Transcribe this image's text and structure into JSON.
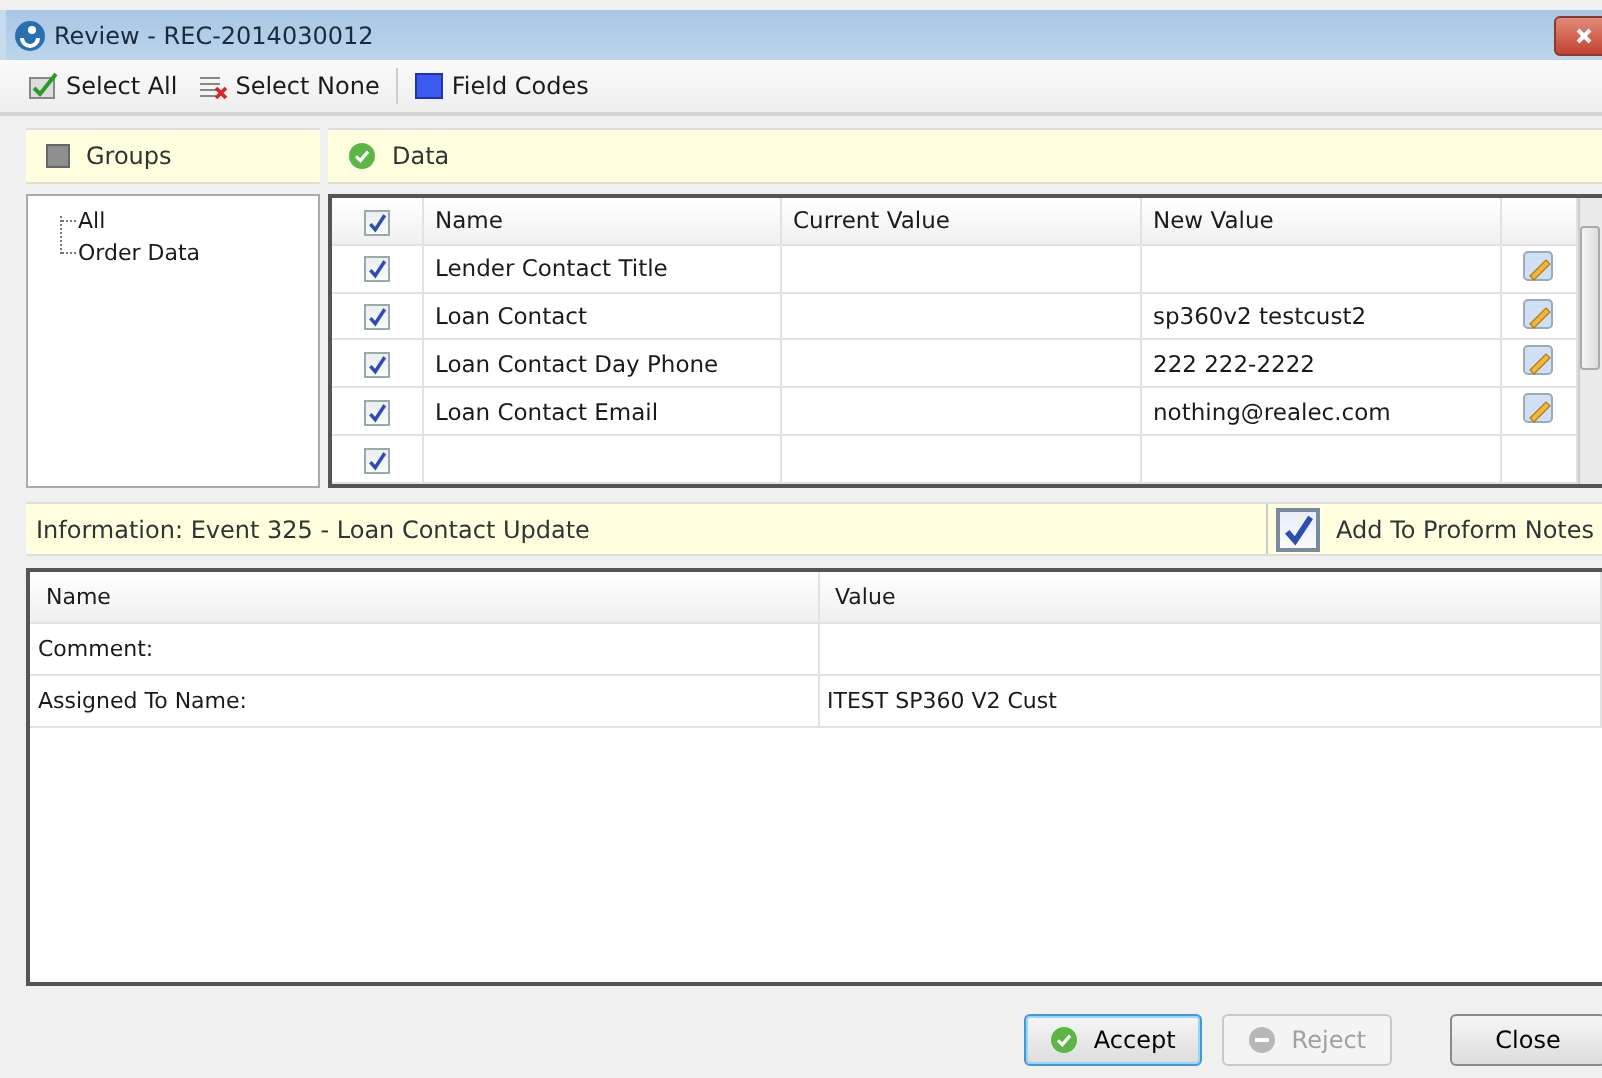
{
  "window": {
    "title": "Review - REC-2014030012"
  },
  "toolbar": [
    {
      "kind": "select-all",
      "label": "Select All"
    },
    {
      "kind": "select-none",
      "label": "Select None"
    },
    {
      "kind": "field-codes",
      "label": "Field Codes"
    }
  ],
  "groups": {
    "title": "Groups",
    "tree": [
      {
        "label": "All"
      },
      {
        "label": "Order Data"
      }
    ]
  },
  "data": {
    "title": "Data",
    "header_checked": true,
    "columns": [
      "Name",
      "Current Value",
      "New Value"
    ],
    "rows": [
      {
        "checked": true,
        "name": "Lender Contact Title",
        "new_value": ""
      },
      {
        "checked": true,
        "name": "Loan Contact",
        "new_value": "sp360v2 testcust2"
      },
      {
        "checked": true,
        "name": "Loan Contact Day Phone",
        "new_value": "222 222-2222"
      },
      {
        "checked": true,
        "name": "Loan Contact Email",
        "new_value": "nothing@realec.com"
      },
      {
        "checked": true
      }
    ]
  },
  "information": {
    "title": "Information: Event 325 - Loan Contact Update",
    "add_to_notes": {
      "label": "Add To Proform Notes",
      "checked": true
    },
    "columns": [
      "Name",
      "Value"
    ],
    "rows": [
      {
        "name": "Comment:",
        "value": ""
      },
      {
        "name": "Assigned To Name:",
        "value": "ITEST SP360 V2 Cust"
      }
    ]
  },
  "buttons": [
    {
      "kind": "accept",
      "label": "Accept",
      "disabled": false
    },
    {
      "kind": "reject",
      "label": "Reject",
      "disabled": true
    },
    {
      "kind": "close",
      "label": "Close",
      "disabled": false
    }
  ]
}
